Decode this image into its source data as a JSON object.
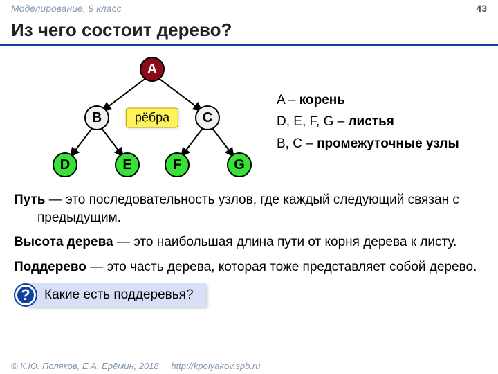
{
  "header": {
    "course": "Моделирование, 9 класс",
    "page": "43"
  },
  "title": "Из чего состоит дерево?",
  "tree": {
    "nodes": {
      "A": "A",
      "B": "B",
      "C": "C",
      "D": "D",
      "E": "E",
      "F": "F",
      "G": "G"
    },
    "edge_label": "рёбра"
  },
  "legend": {
    "line1_prefix": "A –  ",
    "line1_bold": "корень",
    "line2_prefix": "D, E, F, G – ",
    "line2_bold": "листья",
    "line3_prefix": "B, C –   ",
    "line3_bold": "промежуточные узлы"
  },
  "defs": {
    "p1_term": "Путь",
    "p1_rest": " — это последовательность узлов, где каждый следующий связан с предыдущим.",
    "p2_term": "Высота дерева",
    "p2_rest": " — это наибольшая длина пути от корня дерева к листу.",
    "p3_term": "Поддерево",
    "p3_rest": " — это часть дерева, которая тоже представляет собой дерево."
  },
  "question": {
    "mark": "?",
    "text": "Какие есть поддеревья?"
  },
  "footer": {
    "copyright": "© К.Ю. Поляков, Е.А. Ерёмин, 2018",
    "url": "http://kpolyakov.spb.ru"
  }
}
